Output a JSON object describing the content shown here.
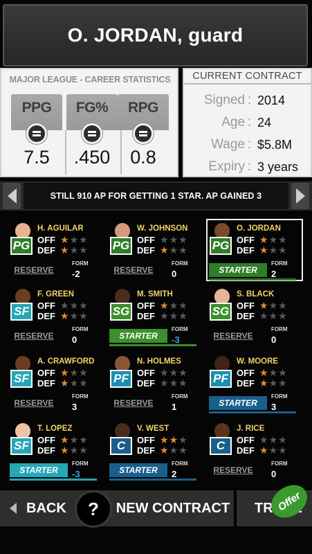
{
  "header": {
    "title": "O. JORDAN, guard"
  },
  "career_stats": {
    "title": "MAJOR LEAGUE - CAREER STATISTICS",
    "stats": [
      {
        "label": "PPG",
        "value": "7.5",
        "icon": "equal-icon"
      },
      {
        "label": "FG%",
        "value": ".450",
        "icon": "equal-icon"
      },
      {
        "label": "RPG",
        "value": "0.8",
        "icon": "equal-icon"
      }
    ]
  },
  "contract": {
    "title": "CURRENT CONTRACT",
    "rows": [
      {
        "key": "Signed",
        "value": "2014"
      },
      {
        "key": "Age",
        "value": "24"
      },
      {
        "key": "Wage",
        "value": "$5.8M"
      },
      {
        "key": "Expiry",
        "value": "3 years"
      }
    ]
  },
  "ap_banner": {
    "message": "STILL 910 AP FOR GETTING 1 STAR.  AP GAINED 3"
  },
  "labels": {
    "off": "OFF",
    "def": "DEF",
    "form": "FORM"
  },
  "colors": {
    "star_on": "#e58a2c",
    "star_off": "#5a5a5a",
    "green": "#3b8f2c",
    "blue": "#1a5f8c",
    "teal": "#25a7b8",
    "name_gold": "#f2d36a"
  },
  "players": [
    {
      "name": "H. AGUILAR",
      "pos": "PG",
      "pos_color": "#2f7d2a",
      "off": 1,
      "def": 1,
      "status": "RESERVE",
      "form": "-2",
      "form_neg": false,
      "skin": "#e8b491"
    },
    {
      "name": "W. JOHNSON",
      "pos": "PG",
      "pos_color": "#2f7d2a",
      "off": 0,
      "def": 1,
      "status": "RESERVE",
      "form": "0",
      "form_neg": false,
      "skin": "#d49a78"
    },
    {
      "name": "O. JORDAN",
      "pos": "PG",
      "pos_color": "#2f7d2a",
      "off": 1,
      "def": 1,
      "status": "STARTER",
      "status_color": "#2f7d2a",
      "form": "2",
      "form_neg": false,
      "skin": "#7a4a2a",
      "selected": true
    },
    {
      "name": "F. GREEN",
      "pos": "SF",
      "pos_color": "#25a7b8",
      "off": 0,
      "def": 1,
      "status": "RESERVE",
      "form": "0",
      "form_neg": false,
      "skin": "#6b3e22"
    },
    {
      "name": "M. SMITH",
      "pos": "SG",
      "pos_color": "#3b8f2c",
      "off": 1,
      "def": 0,
      "status": "STARTER",
      "status_color": "#3b8f2c",
      "form": "-3",
      "form_neg": true,
      "skin": "#4a2e1c"
    },
    {
      "name": "S. BLACK",
      "pos": "SG",
      "pos_color": "#3b8f2c",
      "off": 1,
      "def": 0,
      "status": "RESERVE",
      "form": "0",
      "form_neg": false,
      "skin": "#e6b596"
    },
    {
      "name": "A. CRAWFORD",
      "pos": "SF",
      "pos_color": "#25a7b8",
      "off": 1,
      "def": 1,
      "status": "RESERVE",
      "form": "3",
      "form_neg": false,
      "skin": "#6a3c22"
    },
    {
      "name": "N. HOLMES",
      "pos": "PF",
      "pos_color": "#1a8fb0",
      "off": 0,
      "def": 0,
      "status": "RESERVE",
      "form": "1",
      "form_neg": false,
      "skin": "#8a5634"
    },
    {
      "name": "W. MOORE",
      "pos": "PF",
      "pos_color": "#1a8fb0",
      "off": 1,
      "def": 1,
      "status": "STARTER",
      "status_color": "#1a5f8c",
      "form": "3",
      "form_neg": false,
      "skin": "#3e2416"
    },
    {
      "name": "T. LOPEZ",
      "pos": "SF",
      "pos_color": "#25a7b8",
      "off": 1,
      "def": 1,
      "status": "STARTER",
      "status_color": "#25a7b8",
      "form": "-3",
      "form_neg": true,
      "skin": "#f0c3a2"
    },
    {
      "name": "V. WEST",
      "pos": "C",
      "pos_color": "#1a5f8c",
      "off": 2,
      "def": 1,
      "status": "STARTER",
      "status_color": "#1a5f8c",
      "form": "2",
      "form_neg": false,
      "skin": "#4a2c1c"
    },
    {
      "name": "J. RICE",
      "pos": "C",
      "pos_color": "#1a5f8c",
      "off": 0,
      "def": 1,
      "status": "RESERVE",
      "form": "0",
      "form_neg": false,
      "skin": "#5a341e"
    }
  ],
  "bottom_bar": {
    "back": "BACK",
    "help": "?",
    "new_contract": "NEW CONTRACT",
    "trade": "TRADE",
    "offer_badge": "Offer"
  }
}
